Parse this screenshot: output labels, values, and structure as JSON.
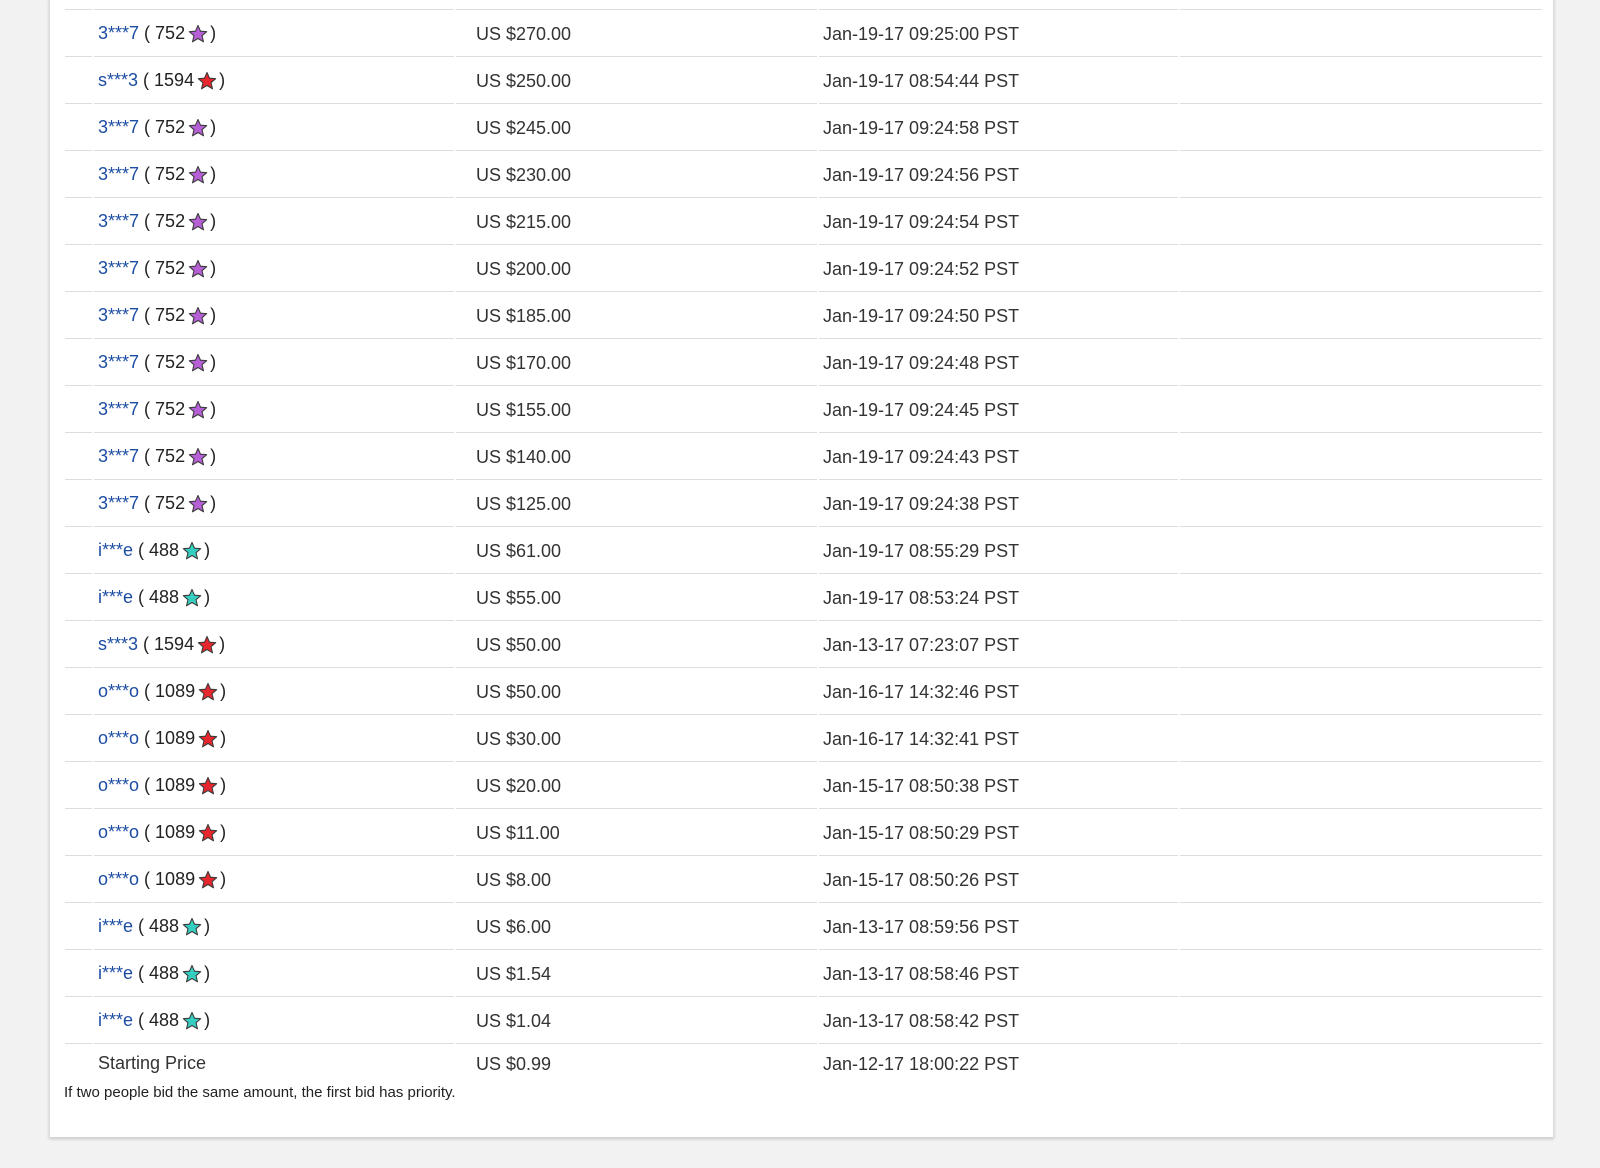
{
  "bids": [
    {
      "bidder": "3***7",
      "score": "752",
      "star": "purple",
      "amount": "US $270.00",
      "time": "Jan-19-17 09:25:00 PST"
    },
    {
      "bidder": "s***3",
      "score": "1594",
      "star": "red",
      "amount": "US $250.00",
      "time": "Jan-19-17 08:54:44 PST"
    },
    {
      "bidder": "3***7",
      "score": "752",
      "star": "purple",
      "amount": "US $245.00",
      "time": "Jan-19-17 09:24:58 PST"
    },
    {
      "bidder": "3***7",
      "score": "752",
      "star": "purple",
      "amount": "US $230.00",
      "time": "Jan-19-17 09:24:56 PST"
    },
    {
      "bidder": "3***7",
      "score": "752",
      "star": "purple",
      "amount": "US $215.00",
      "time": "Jan-19-17 09:24:54 PST"
    },
    {
      "bidder": "3***7",
      "score": "752",
      "star": "purple",
      "amount": "US $200.00",
      "time": "Jan-19-17 09:24:52 PST"
    },
    {
      "bidder": "3***7",
      "score": "752",
      "star": "purple",
      "amount": "US $185.00",
      "time": "Jan-19-17 09:24:50 PST"
    },
    {
      "bidder": "3***7",
      "score": "752",
      "star": "purple",
      "amount": "US $170.00",
      "time": "Jan-19-17 09:24:48 PST"
    },
    {
      "bidder": "3***7",
      "score": "752",
      "star": "purple",
      "amount": "US $155.00",
      "time": "Jan-19-17 09:24:45 PST"
    },
    {
      "bidder": "3***7",
      "score": "752",
      "star": "purple",
      "amount": "US $140.00",
      "time": "Jan-19-17 09:24:43 PST"
    },
    {
      "bidder": "3***7",
      "score": "752",
      "star": "purple",
      "amount": "US $125.00",
      "time": "Jan-19-17 09:24:38 PST"
    },
    {
      "bidder": "i***e",
      "score": "488",
      "star": "turquoise",
      "amount": "US $61.00",
      "time": "Jan-19-17 08:55:29 PST"
    },
    {
      "bidder": "i***e",
      "score": "488",
      "star": "turquoise",
      "amount": "US $55.00",
      "time": "Jan-19-17 08:53:24 PST"
    },
    {
      "bidder": "s***3",
      "score": "1594",
      "star": "red",
      "amount": "US $50.00",
      "time": "Jan-13-17 07:23:07 PST"
    },
    {
      "bidder": "o***o",
      "score": "1089",
      "star": "red",
      "amount": "US $50.00",
      "time": "Jan-16-17 14:32:46 PST"
    },
    {
      "bidder": "o***o",
      "score": "1089",
      "star": "red",
      "amount": "US $30.00",
      "time": "Jan-16-17 14:32:41 PST"
    },
    {
      "bidder": "o***o",
      "score": "1089",
      "star": "red",
      "amount": "US $20.00",
      "time": "Jan-15-17 08:50:38 PST"
    },
    {
      "bidder": "o***o",
      "score": "1089",
      "star": "red",
      "amount": "US $11.00",
      "time": "Jan-15-17 08:50:29 PST"
    },
    {
      "bidder": "o***o",
      "score": "1089",
      "star": "red",
      "amount": "US $8.00",
      "time": "Jan-15-17 08:50:26 PST"
    },
    {
      "bidder": "i***e",
      "score": "488",
      "star": "turquoise",
      "amount": "US $6.00",
      "time": "Jan-13-17 08:59:56 PST"
    },
    {
      "bidder": "i***e",
      "score": "488",
      "star": "turquoise",
      "amount": "US $1.54",
      "time": "Jan-13-17 08:58:46 PST"
    },
    {
      "bidder": "i***e",
      "score": "488",
      "star": "turquoise",
      "amount": "US $1.04",
      "time": "Jan-13-17 08:58:42 PST"
    }
  ],
  "starting": {
    "label": "Starting Price",
    "amount": "US $0.99",
    "time": "Jan-12-17 18:00:22 PST"
  },
  "note": "If two people bid the same amount, the first bid has priority.",
  "star_colors": {
    "purple": "#b65fd6",
    "red": "#e8262d",
    "turquoise": "#34cfc2"
  },
  "link_color": "#1c4da3"
}
